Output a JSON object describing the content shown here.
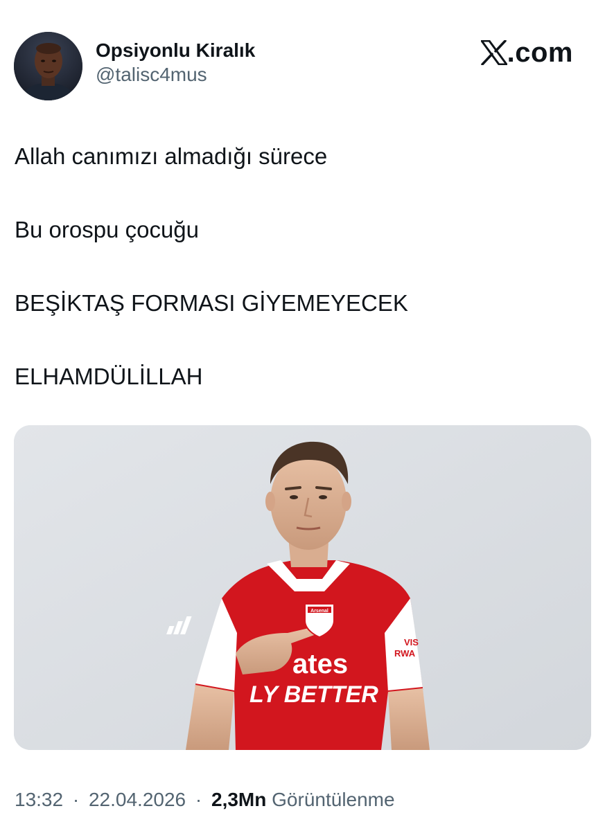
{
  "tweet": {
    "author": {
      "display_name": "Opsiyonlu Kiralık",
      "handle": "@talisc4mus"
    },
    "source": {
      "logo_icon": "x-logo-icon",
      "domain_suffix": ".com"
    },
    "lines": [
      "Allah canımızı almadığı sürece",
      "Bu orospu çocuğu",
      "BEŞİKTAŞ FORMASI GİYEMEYECEK",
      "ELHAMDÜLİLLAH"
    ],
    "media": {
      "kit_club_badge_text": "Arsenal",
      "kit_sponsor_text_top": "ates",
      "kit_sponsor_text_bottom": "LY BETTER",
      "sleeve_sponsor_top": "VIS",
      "sleeve_sponsor_bottom": "RWA"
    },
    "meta": {
      "time": "13:32",
      "separator": "·",
      "date": "22.04.2026",
      "views_count": "2,3Mn",
      "views_label": "Görüntülenme"
    }
  },
  "colors": {
    "text_primary": "#0f1419",
    "text_secondary": "#536471",
    "kit_red": "#d2161e",
    "kit_white": "#ffffff",
    "media_bg": "#dcdfe3"
  }
}
